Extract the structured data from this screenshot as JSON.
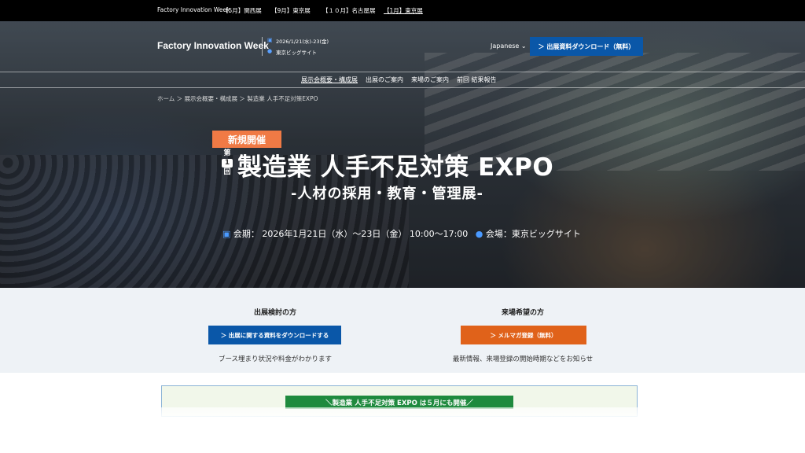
{
  "topbar": {
    "items": [
      "Factory Innovation Week",
      "【5月】関西展",
      "【9月】東京展",
      "【１０月】名古屋展",
      "【1月】東京展"
    ]
  },
  "header": {
    "logo": "Factory Innovation Week",
    "date": "2026/1/21(水)-23(金)",
    "venue": "東京ビッグサイト",
    "language": "Japanese",
    "download_button": "＞ 出展資料ダウンロード（無料）"
  },
  "nav": {
    "items": [
      "展示会概要・構成展",
      "出展のご案内",
      "来場のご案内",
      "前回 結果報告"
    ]
  },
  "breadcrumb": "ホーム ＞ 展示会概要・構成展 ＞ 製造業 人手不足対策EXPO",
  "hero": {
    "badge": "新規開催",
    "edition_top": "第",
    "edition_num": "1",
    "edition_bottom": "回",
    "title": "製造業 人手不足対策 EXPO",
    "subtitle": "-人材の採用・教育・管理展-",
    "date_info": "会期： 2026年1月21日（水）～23日（金） 10:00～17:00",
    "venue_info": "会場：東京ビッグサイト"
  },
  "cta": {
    "exhibitor": {
      "heading": "出展検討の方",
      "button": "＞ 出展に関する資料をダウンロードする",
      "desc": "ブース埋まり状況や料金がわかります"
    },
    "visitor": {
      "heading": "来場希望の方",
      "button": "＞ メルマガ登録（無料）",
      "desc": "最新情報、来場登録の開始時期などをお知らせ"
    }
  },
  "notice": {
    "label": "＼製造業 人手不足対策 EXPO は５月にも開催／"
  },
  "colors": {
    "primary_blue": "#0a57a8",
    "accent_orange": "#e0621a",
    "badge_orange": "#f07a45",
    "notice_green": "#1e8a3e"
  }
}
